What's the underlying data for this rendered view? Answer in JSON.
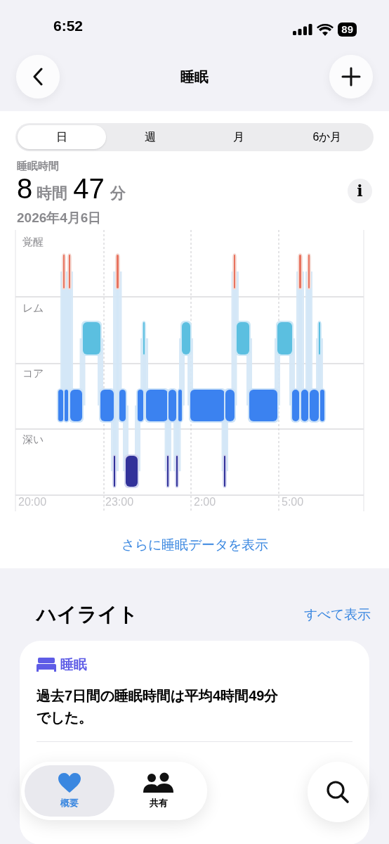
{
  "status_bar": {
    "time": "6:52",
    "battery": "89"
  },
  "nav": {
    "title": "睡眠"
  },
  "tabs": [
    {
      "label": "日",
      "selected": true
    },
    {
      "label": "週",
      "selected": false
    },
    {
      "label": "月",
      "selected": false
    },
    {
      "label": "6か月",
      "selected": false
    }
  ],
  "summary": {
    "label": "睡眠時間",
    "hours": "8",
    "hours_unit": "時間",
    "minutes": "47",
    "minutes_unit": "分",
    "date": "2026年4月6日",
    "info": "i"
  },
  "chart": {
    "stages": [
      "覚醒",
      "レム",
      "コア",
      "深い"
    ],
    "times": [
      "20:00",
      "23:00",
      "2:00",
      "5:00"
    ]
  },
  "more_link": "さらに睡眠データを表示",
  "highlights": {
    "title": "ハイライト",
    "see_all": "すべて表示",
    "card": {
      "category": "睡眠",
      "text": "過去7日間の睡眠時間は平均4時間49分でした。"
    }
  },
  "tab_bar": [
    {
      "label": "概要",
      "selected": true,
      "kind": "summary"
    },
    {
      "label": "共有",
      "selected": false,
      "kind": "sharing"
    }
  ]
}
